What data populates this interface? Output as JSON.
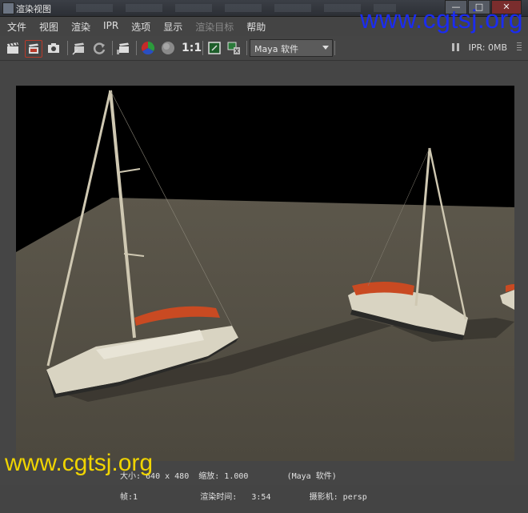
{
  "window": {
    "title": "渲染视图",
    "close_glyph": "✕",
    "max_glyph": "□",
    "min_glyph": "—"
  },
  "watermark": {
    "top": "www.cgtsj.org",
    "bottom": "www.cgtsj.org"
  },
  "menu": [
    {
      "label": "文件",
      "enabled": true
    },
    {
      "label": "视图",
      "enabled": true
    },
    {
      "label": "渲染",
      "enabled": true
    },
    {
      "label": "IPR",
      "enabled": true
    },
    {
      "label": "选项",
      "enabled": true
    },
    {
      "label": "显示",
      "enabled": true
    },
    {
      "label": "渲染目标",
      "enabled": false
    },
    {
      "label": "帮助",
      "enabled": true
    }
  ],
  "toolbar": {
    "ratio_label": "1:1",
    "renderer": "Maya 软件",
    "ipr_status": "IPR: 0MB"
  },
  "stats": {
    "line1": "大小: 640 x 480  缩放: 1.000        (Maya 软件)",
    "line2": "帧:1             渲染时间:   3:54        摄影机: persp"
  },
  "colors": {
    "watermark_top": "#1b2cf0",
    "watermark_bottom": "#f0d400",
    "ipr_accent": "#b83a2a"
  }
}
